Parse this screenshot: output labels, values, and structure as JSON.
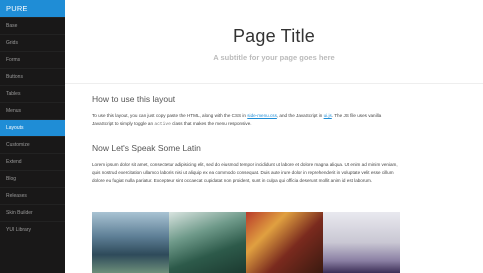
{
  "sidebar": {
    "brand": "PURE",
    "items": [
      {
        "label": "Base"
      },
      {
        "label": "Grids"
      },
      {
        "label": "Forms"
      },
      {
        "label": "Buttons"
      },
      {
        "label": "Tables"
      },
      {
        "label": "Menus"
      },
      {
        "label": "Layouts",
        "active": true
      },
      {
        "label": "Customize"
      },
      {
        "label": "Extend"
      },
      {
        "label": "Blog"
      },
      {
        "label": "Releases"
      },
      {
        "label": "Skin Builder"
      },
      {
        "label": "YUI Library"
      }
    ]
  },
  "header": {
    "title": "Page Title",
    "subtitle": "A subtitle for your page goes here"
  },
  "content": {
    "section1_title": "How to use this layout",
    "section1_text_a": "To use this layout, you can just copy paste the HTML, along with the CSS in ",
    "section1_link1": "side-menu.css",
    "section1_text_b": ", and the JavaScript in ",
    "section1_link2": "ui.js",
    "section1_text_c": ". The JS file uses vanilla JavaScript to simply toggle an ",
    "section1_code": "active",
    "section1_text_d": " class that makes the menu responsive.",
    "section2_title": "Now Let's Speak Some Latin",
    "section2_text": "Lorem ipsum dolor sit amet, consectetur adipisicing elit, sed do eiusmod tempor incididunt ut labore et dolore magna aliqua. Ut enim ad minim veniam, quis nostrud exercitation ullamco laboris nisi ut aliquip ex ea commodo consequat. Duis aute irure dolor in reprehenderit in voluptate velit esse cillum dolore eu fugiat nulla pariatur. Excepteur sint occaecat cupidatat non proident, sunt in culpa qui officia deserunt mollit anim id est laborum."
  },
  "photos": [
    {
      "subject": "mountain-lake"
    },
    {
      "subject": "forest-trees"
    },
    {
      "subject": "market-fabrics"
    },
    {
      "subject": "snowy-mountain"
    }
  ],
  "colors": {
    "sidebar_bg": "#191818",
    "accent": "#1f8dd6",
    "title_text": "#333333"
  }
}
